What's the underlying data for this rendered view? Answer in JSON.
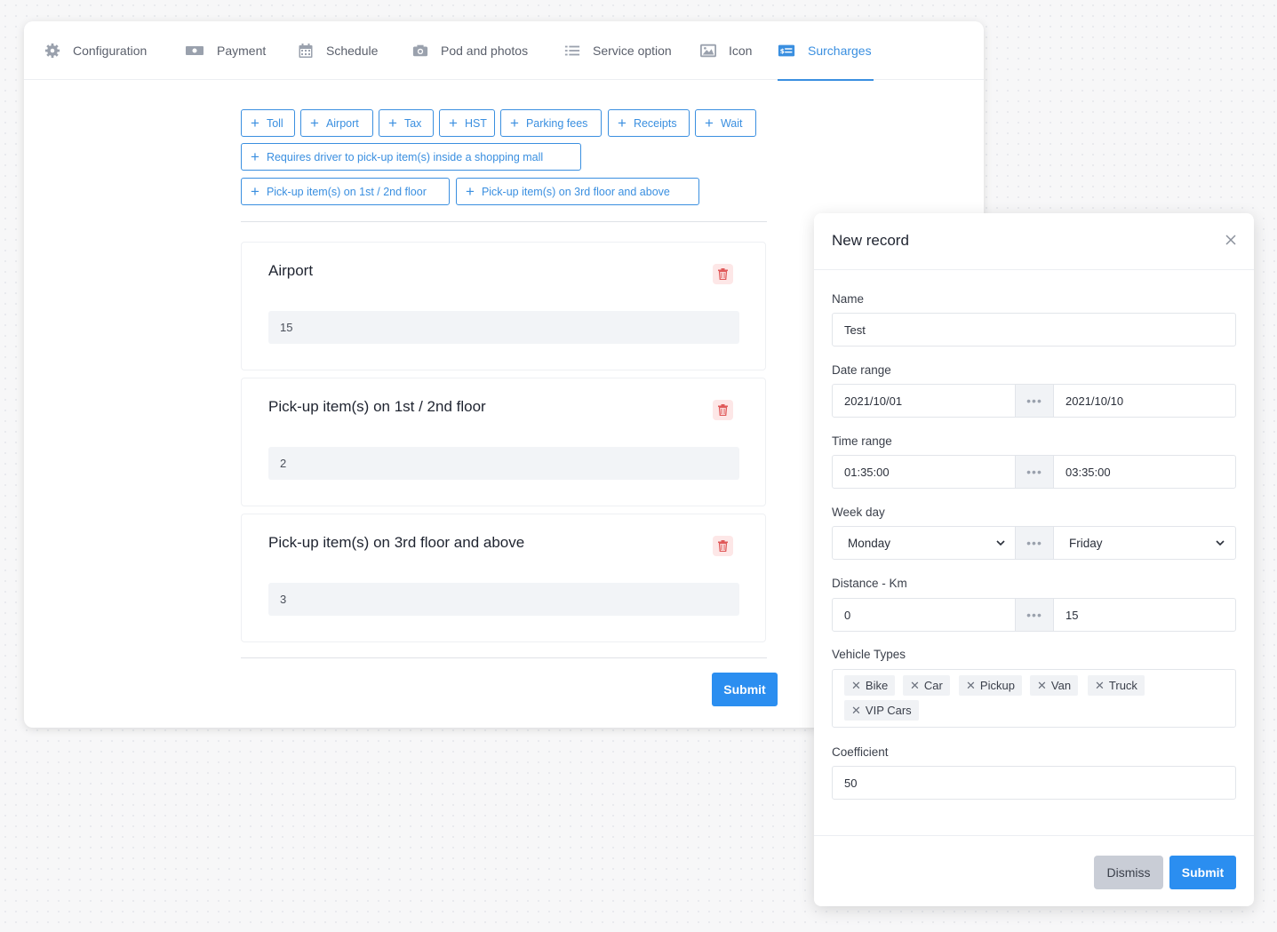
{
  "tabs": [
    {
      "label": "Configuration",
      "icon": "gear-icon"
    },
    {
      "label": "Payment",
      "icon": "banknote-icon"
    },
    {
      "label": "Schedule",
      "icon": "calendar-icon"
    },
    {
      "label": "Pod and photos",
      "icon": "camera-icon"
    },
    {
      "label": "Service option",
      "icon": "list-icon"
    },
    {
      "label": "Icon",
      "icon": "image-icon"
    },
    {
      "label": "Surcharges",
      "icon": "dollar-card-icon",
      "active": true
    }
  ],
  "chips": [
    "Toll",
    "Airport",
    "Tax",
    "HST",
    "Parking fees",
    "Receipts",
    "Wait",
    "Requires driver to pick-up item(s) inside a shopping mall",
    "Pick-up item(s) on 1st / 2nd floor",
    "Pick-up item(s) on 3rd floor and above"
  ],
  "surcharges": [
    {
      "title": "Airport",
      "value": "15"
    },
    {
      "title": "Pick-up item(s) on 1st / 2nd floor",
      "value": "2"
    },
    {
      "title": "Pick-up item(s) on 3rd floor and above",
      "value": "3"
    }
  ],
  "main_submit": "Submit",
  "modal": {
    "title": "New record",
    "name_label": "Name",
    "name_value": "Test",
    "date_label": "Date range",
    "date_from": "2021/10/01",
    "date_to": "2021/10/10",
    "time_label": "Time range",
    "time_from": "01:35:00",
    "time_to": "03:35:00",
    "weekday_label": "Week day",
    "weekday_from": "Monday",
    "weekday_to": "Friday",
    "distance_label": "Distance - Km",
    "distance_from": "0",
    "distance_to": "15",
    "separator": "•••",
    "vehicle_label": "Vehicle Types",
    "vehicles": [
      "Bike",
      "Car",
      "Pickup",
      "Van",
      "Truck",
      "VIP Cars"
    ],
    "coefficient_label": "Coefficient",
    "coefficient_value": "50",
    "dismiss": "Dismiss",
    "submit": "Submit"
  },
  "colors": {
    "accent": "#2b8ef0",
    "danger": "#e05a5a"
  }
}
